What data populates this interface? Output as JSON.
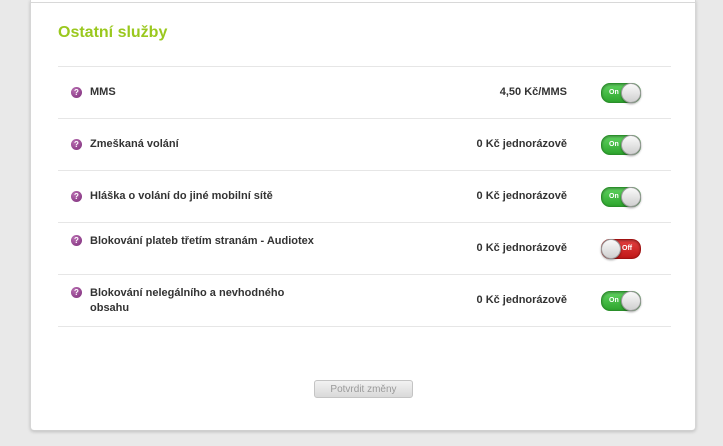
{
  "section": {
    "title": "Ostatní služby"
  },
  "services": [
    {
      "name": "MMS",
      "price": "4,50 Kč/MMS",
      "toggle": "On",
      "enabled": true
    },
    {
      "name": "Zmeškaná volání",
      "price": "0 Kč jednorázově",
      "toggle": "On",
      "enabled": true
    },
    {
      "name": "Hláška o volání do jiné mobilní sítě",
      "price": "0 Kč jednorázově",
      "toggle": "On",
      "enabled": true
    },
    {
      "name": "Blokování plateb třetím stranám - Audiotex",
      "price": "0 Kč jednorázově",
      "toggle": "Off",
      "enabled": false
    },
    {
      "name": "Blokování nelegálního a nevhodného obsahu",
      "price": "0 Kč jednorázově",
      "toggle": "On",
      "enabled": true
    }
  ],
  "help_icon_glyph": "?",
  "actions": {
    "confirm_label": "Potvrdit změny"
  },
  "colors": {
    "title": "#9ac81e",
    "toggle_on": "#2ea52e",
    "toggle_off": "#c01818",
    "help_icon": "#8e3f8a"
  }
}
